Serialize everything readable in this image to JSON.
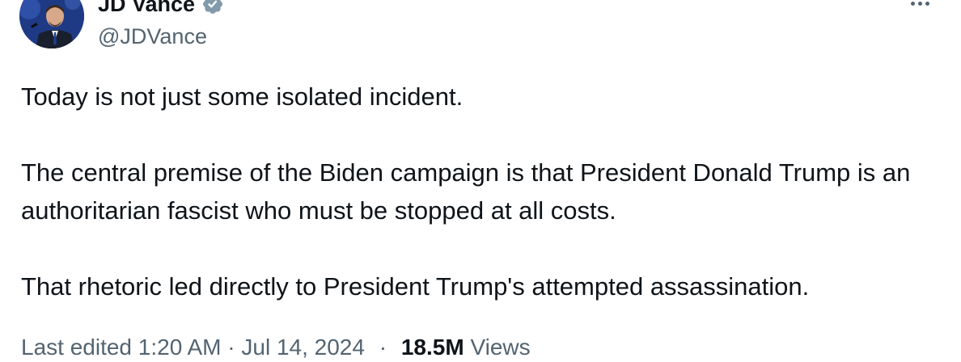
{
  "author": {
    "display_name": "JD Vance",
    "handle": "@JDVance",
    "verified": true
  },
  "tweet": {
    "paragraphs": [
      "Today is not just some isolated incident.",
      "The central premise of the Biden campaign is that President Donald Trump is an authoritarian fascist who must be stopped at all costs.",
      "That rhetoric led directly to President Trump's attempted assassination."
    ]
  },
  "meta": {
    "edited_time": "Last edited 1:20 AM · Jul 14, 2024",
    "separator": "·",
    "views_count": "18.5M",
    "views_label": "Views"
  },
  "icons": {
    "verified": "verified-badge-icon",
    "more": "more-options-icon"
  },
  "colors": {
    "text_primary": "#0f1419",
    "text_secondary": "#536471",
    "verified_badge": "#829aab"
  }
}
